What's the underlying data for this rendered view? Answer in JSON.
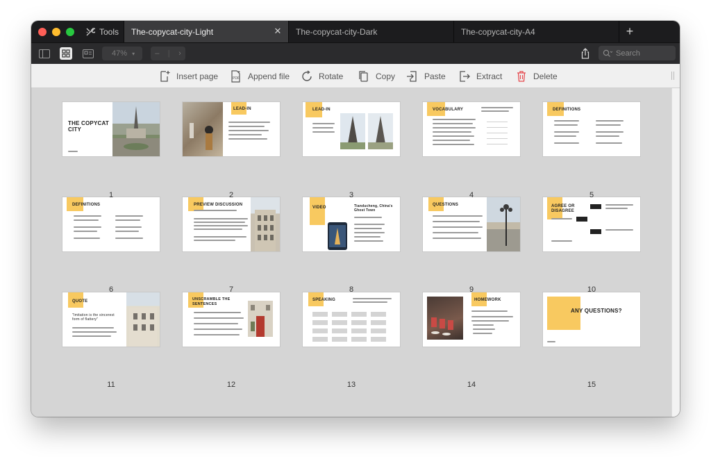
{
  "window": {
    "tools_label": "Tools",
    "tabs": [
      {
        "label": "The-copycat-city-Light",
        "active": true
      },
      {
        "label": "The-copycat-city-Dark",
        "active": false
      },
      {
        "label": "The-copycat-city-A4",
        "active": false
      }
    ]
  },
  "toolbar": {
    "zoom": "47%",
    "search_placeholder": "Search"
  },
  "actions": [
    {
      "id": "insert-page",
      "label": "Insert page",
      "icon": "insert-page-icon"
    },
    {
      "id": "append-file",
      "label": "Append file",
      "icon": "pdf-file-icon"
    },
    {
      "id": "rotate",
      "label": "Rotate",
      "icon": "rotate-icon"
    },
    {
      "id": "copy",
      "label": "Copy",
      "icon": "copy-icon"
    },
    {
      "id": "paste",
      "label": "Paste",
      "icon": "paste-icon"
    },
    {
      "id": "extract",
      "label": "Extract",
      "icon": "extract-icon"
    },
    {
      "id": "delete",
      "label": "Delete",
      "icon": "trash-icon"
    }
  ],
  "pages": [
    {
      "number": "1",
      "title": "THE COPYCAT CITY"
    },
    {
      "number": "2",
      "title": "LEAD-IN"
    },
    {
      "number": "3",
      "title": "LEAD-IN"
    },
    {
      "number": "4",
      "title": "VOCABULARY"
    },
    {
      "number": "5",
      "title": "DEFINITIONS"
    },
    {
      "number": "6",
      "title": "DEFINITIONS"
    },
    {
      "number": "7",
      "title": "PREVIEW DISCUSSION"
    },
    {
      "number": "8",
      "title": "VIDEO",
      "subtitle": "Tianducheng, China's Ghost Town"
    },
    {
      "number": "9",
      "title": "QUESTIONS"
    },
    {
      "number": "10",
      "title": "AGREE OR DISAGREE"
    },
    {
      "number": "11",
      "title": "QUOTE",
      "quote": "\"Imitation is the sincerest form of flattery\""
    },
    {
      "number": "12",
      "title": "UNSCRAMBLE THE SENTENCES"
    },
    {
      "number": "13",
      "title": "SPEAKING"
    },
    {
      "number": "14",
      "title": "HOMEWORK"
    },
    {
      "number": "15",
      "title": "ANY QUESTIONS?"
    }
  ],
  "colors": {
    "accent_yellow": "#f8c960",
    "close_red": "#ff5f57",
    "minimize_yellow": "#febc2e",
    "zoom_green": "#28c840",
    "delete_red": "#e5484d"
  }
}
